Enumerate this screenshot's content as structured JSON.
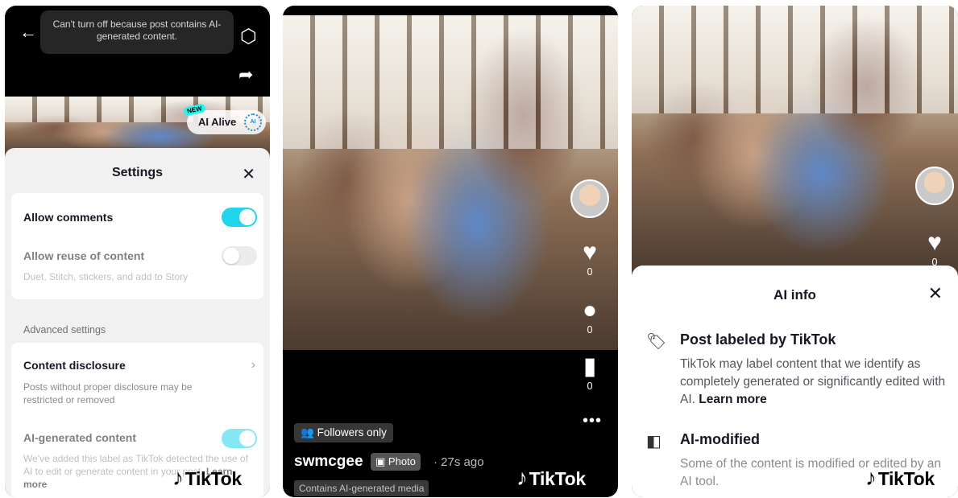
{
  "panel1": {
    "toast": "Can't turn off because post contains AI-generated content.",
    "ai_alive": {
      "badge": "NEW",
      "label": "AI Alive",
      "ring": "AI"
    },
    "settings": {
      "title": "Settings",
      "close": "✕",
      "allow_comments": {
        "label": "Allow comments",
        "state": "on"
      },
      "allow_reuse": {
        "label": "Allow reuse of content",
        "sub": "Duet, Stitch, stickers, and add to Story",
        "state": "off"
      },
      "advanced_label": "Advanced settings",
      "content_disclosure": {
        "label": "Content disclosure",
        "sub": "Posts without proper disclosure may be restricted or removed"
      },
      "ai_generated": {
        "label": "AI-generated content",
        "sub": "We've added this label as TikTok detected the use of AI to edit or generate content in your post.",
        "link": "Learn more",
        "state": "on"
      }
    }
  },
  "panel2": {
    "likes": "0",
    "comments": "0",
    "saves": "0",
    "followers_only": "Followers only",
    "username": "swmcgee",
    "media_type": "Photo",
    "time": "· 27s ago",
    "ai_chip": "Contains AI-generated media"
  },
  "panel3": {
    "likes": "0",
    "title": "AI info",
    "close": "✕",
    "labeled": {
      "heading": "Post labeled by TikTok",
      "body": "TikTok may label content that we identify as completely generated or significantly edited with AI.",
      "link": "Learn more"
    },
    "modified": {
      "heading": "AI-modified",
      "body": "Some of the content is modified or edited by an AI tool."
    }
  },
  "watermark": "TikTok",
  "colors": {
    "toggle_on": "#20d5ec",
    "sheet_bg": "#f1f1f2"
  }
}
